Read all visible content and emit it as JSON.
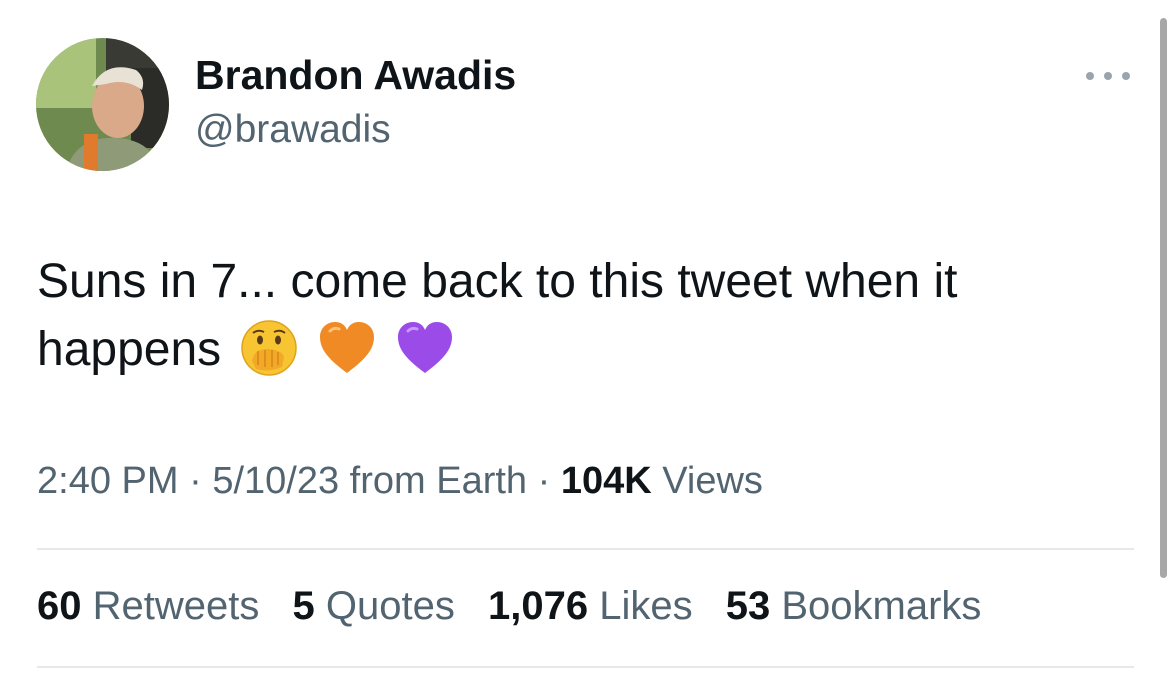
{
  "author": {
    "name": "Brandon Awadis",
    "handle": "@brawadis"
  },
  "tweet": {
    "text_line1": "Suns in 7... come back to this tweet when it",
    "text_line2": "happens",
    "emojis": [
      "face-with-hand-over-mouth-icon",
      "orange-heart-icon",
      "purple-heart-icon"
    ]
  },
  "meta": {
    "time": "2:40 PM",
    "date": "5/10/23",
    "source": "from Earth",
    "views_count": "104K",
    "views_label": "Views",
    "separator": "·"
  },
  "stats": {
    "retweets_count": "60",
    "retweets_label": "Retweets",
    "quotes_count": "5",
    "quotes_label": "Quotes",
    "likes_count": "1,076",
    "likes_label": "Likes",
    "bookmarks_count": "53",
    "bookmarks_label": "Bookmarks"
  },
  "colors": {
    "primary_text": "#0f1419",
    "secondary_text": "#536471",
    "divider": "#e6e9ec",
    "orange_heart": "#f08a24",
    "purple_heart": "#9b4ce8"
  }
}
